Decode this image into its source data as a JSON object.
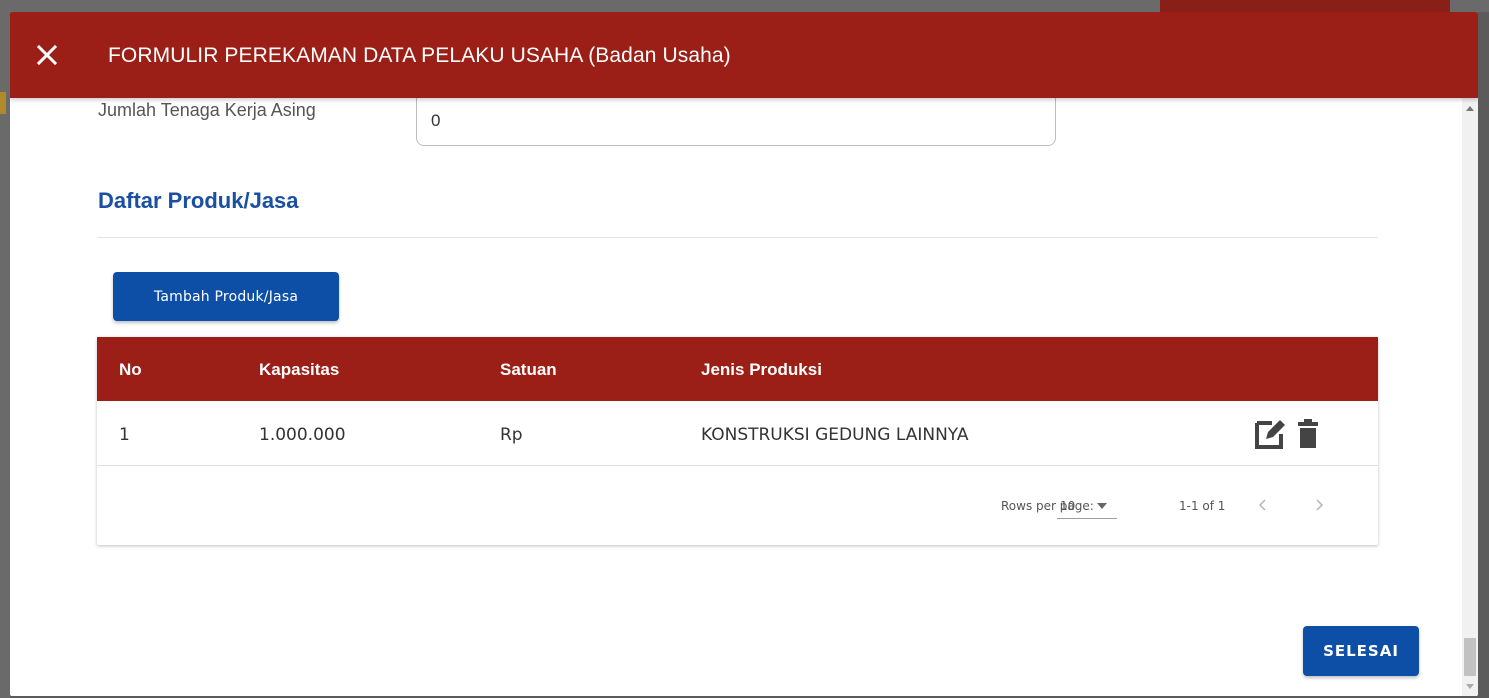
{
  "dialog": {
    "title": "FORMULIR PEREKAMAN DATA PELAKU USAHA (Badan Usaha)",
    "close_icon": "close-icon"
  },
  "form": {
    "foreign_workers_label": "Jumlah Tenaga Kerja Asing",
    "foreign_workers_value": "0"
  },
  "products": {
    "section_title": "Daftar Produk/Jasa",
    "add_button_label": "Tambah Produk/Jasa",
    "columns": [
      "No",
      "Kapasitas",
      "Satuan",
      "Jenis Produksi"
    ],
    "rows": [
      {
        "no": "1",
        "kapasitas": "1.000.000",
        "satuan": "Rp",
        "jenis_produksi": "KONSTRUKSI GEDUNG LAINNYA",
        "actions": [
          "edit-icon",
          "delete-icon"
        ]
      }
    ],
    "pagination": {
      "rows_per_page_label": "Rows per page:",
      "rows_per_page_value": "10",
      "range_text": "1-1 of 1"
    }
  },
  "finish_button_label": "SELESAI",
  "colors": {
    "header_bg": "#9b1f17",
    "primary_button": "#0d4ea6",
    "section_title": "#1b4fa0"
  }
}
